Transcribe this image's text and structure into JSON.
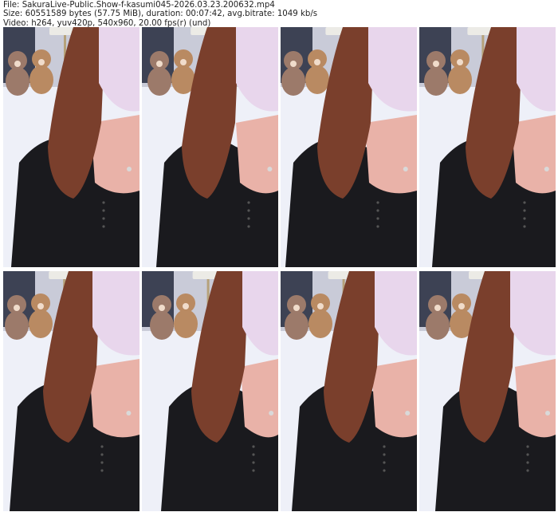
{
  "header": {
    "file_line": "File: SakuraLive-Public.Show-f-kasumi045-2026.03.23.200632.mp4",
    "size_line": "Size: 60551589 bytes (57.75 MiB), duration: 00:07:42, avg.bitrate: 1049 kb/s",
    "video_line": "Video: h264, yuv420p, 540x960, 20.00 fps(r) (und)"
  },
  "thumbnails": [
    {
      "index": 1
    },
    {
      "index": 2
    },
    {
      "index": 3
    },
    {
      "index": 4
    },
    {
      "index": 5
    },
    {
      "index": 6
    },
    {
      "index": 7
    },
    {
      "index": 8
    }
  ],
  "colors": {
    "background": "#ffffff",
    "wall": "#c9cbd8",
    "blanket": "#eef0f8",
    "shirt": "#1a1a1e",
    "hair": "#7a3f2c",
    "mask": "#e8d6ec",
    "skin": "#e9b2a8",
    "skirt": "#6b3848",
    "bear": "#b98a62",
    "lamp": "#ecebe6"
  }
}
